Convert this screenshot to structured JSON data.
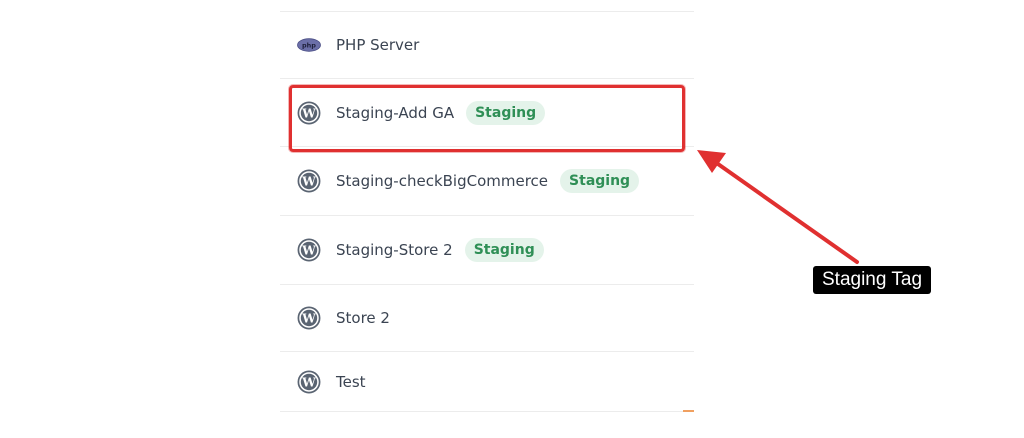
{
  "sites": [
    {
      "name": "PHP Server",
      "icon": "php-icon",
      "badge": ""
    },
    {
      "name": "Staging-Add GA",
      "icon": "wordpress-icon",
      "badge": "Staging"
    },
    {
      "name": "Staging-checkBigCommerce",
      "icon": "wordpress-icon",
      "badge": "Staging"
    },
    {
      "name": "Staging-Store 2",
      "icon": "wordpress-icon",
      "badge": "Staging"
    },
    {
      "name": "Store 2",
      "icon": "wordpress-icon",
      "badge": ""
    },
    {
      "name": "Test",
      "icon": "wordpress-icon",
      "badge": ""
    }
  ],
  "annotation": {
    "label": "Staging Tag",
    "color": "#e03030"
  },
  "colors": {
    "badge_bg": "#e4f3ea",
    "badge_text": "#2f8f56",
    "site_text": "#3b4452",
    "icon": "#5a6472"
  }
}
